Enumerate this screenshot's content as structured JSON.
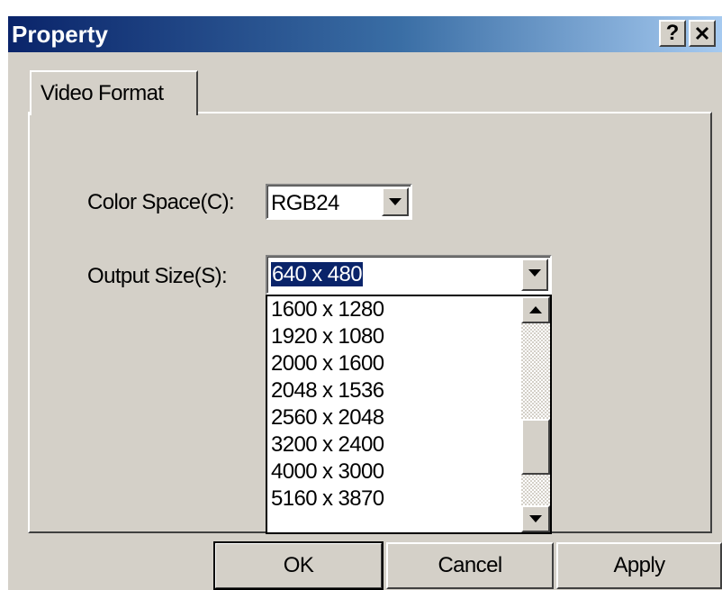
{
  "window": {
    "title": "Property",
    "help_label": "?",
    "close_icon": "close-icon"
  },
  "tabs": [
    {
      "label": "Video Format",
      "active": true
    }
  ],
  "form": {
    "color_space": {
      "label": "Color Space(C):",
      "value": "RGB24"
    },
    "output_size": {
      "label": "Output Size(S):",
      "value": "640 x 480",
      "options_visible": [
        "1600 x 1280",
        "1920 x 1080",
        "2000 x 1600",
        "2048 x 1536",
        "2560 x 2048",
        "3200 x 2400",
        "4000 x 3000",
        "5160 x 3870"
      ]
    }
  },
  "buttons": {
    "ok": "OK",
    "cancel": "Cancel",
    "apply": "Apply"
  },
  "colors": {
    "title_start": "#0a246a",
    "title_end": "#a6caf0",
    "face": "#d4d0c8",
    "selection": "#0a246a"
  }
}
